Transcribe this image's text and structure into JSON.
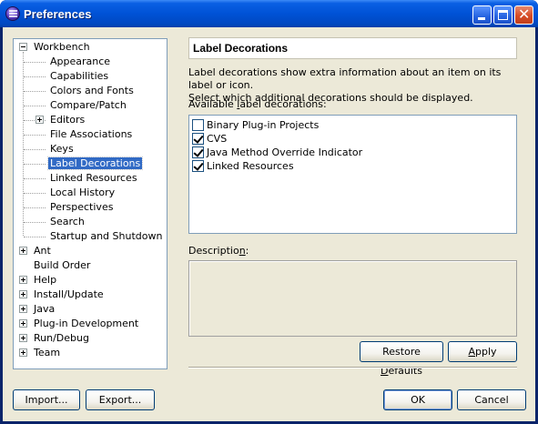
{
  "window": {
    "title": "Preferences"
  },
  "tree": {
    "items": [
      {
        "label": "Workbench",
        "level": 0,
        "expander": "minus",
        "selected": false
      },
      {
        "label": "Appearance",
        "level": 1,
        "selected": false
      },
      {
        "label": "Capabilities",
        "level": 1,
        "selected": false
      },
      {
        "label": "Colors and Fonts",
        "level": 1,
        "selected": false
      },
      {
        "label": "Compare/Patch",
        "level": 1,
        "selected": false
      },
      {
        "label": "Editors",
        "level": 1,
        "expander": "plus",
        "selected": false
      },
      {
        "label": "File Associations",
        "level": 1,
        "selected": false
      },
      {
        "label": "Keys",
        "level": 1,
        "selected": false
      },
      {
        "label": "Label Decorations",
        "level": 1,
        "selected": true
      },
      {
        "label": "Linked Resources",
        "level": 1,
        "selected": false
      },
      {
        "label": "Local History",
        "level": 1,
        "selected": false
      },
      {
        "label": "Perspectives",
        "level": 1,
        "selected": false
      },
      {
        "label": "Search",
        "level": 1,
        "selected": false
      },
      {
        "label": "Startup and Shutdown",
        "level": 1,
        "selected": false
      },
      {
        "label": "Ant",
        "level": 0,
        "expander": "plus",
        "selected": false
      },
      {
        "label": "Build Order",
        "level": 0,
        "selected": false
      },
      {
        "label": "Help",
        "level": 0,
        "expander": "plus",
        "selected": false
      },
      {
        "label": "Install/Update",
        "level": 0,
        "expander": "plus",
        "selected": false
      },
      {
        "label": "Java",
        "level": 0,
        "expander": "plus",
        "selected": false
      },
      {
        "label": "Plug-in Development",
        "level": 0,
        "expander": "plus",
        "selected": false
      },
      {
        "label": "Run/Debug",
        "level": 0,
        "expander": "plus",
        "selected": false
      },
      {
        "label": "Team",
        "level": 0,
        "expander": "plus",
        "selected": false
      }
    ]
  },
  "page": {
    "title": "Label Decorations",
    "description_line1": "Label decorations show extra information about an item on its label or icon.",
    "description_line2": "Select which additional decorations should be displayed.",
    "available_label_pre": "Available ",
    "available_label_mnemonic": "l",
    "available_label_post": "abel decorations:",
    "decorations": [
      {
        "label": "Binary Plug-in Projects",
        "checked": false
      },
      {
        "label": "CVS",
        "checked": true
      },
      {
        "label": "Java Method Override Indicator",
        "checked": true
      },
      {
        "label": "Linked Resources",
        "checked": true
      }
    ],
    "description_label_pre": "Descriptio",
    "description_label_mnemonic": "n",
    "description_label_post": ":",
    "restore_pre": "Restore ",
    "restore_mnemonic": "D",
    "restore_post": "efaults",
    "apply_mnemonic": "A",
    "apply_post": "pply"
  },
  "footer": {
    "import_label": "Import...",
    "export_label": "Export...",
    "ok_label": "OK",
    "cancel_label": "Cancel"
  }
}
